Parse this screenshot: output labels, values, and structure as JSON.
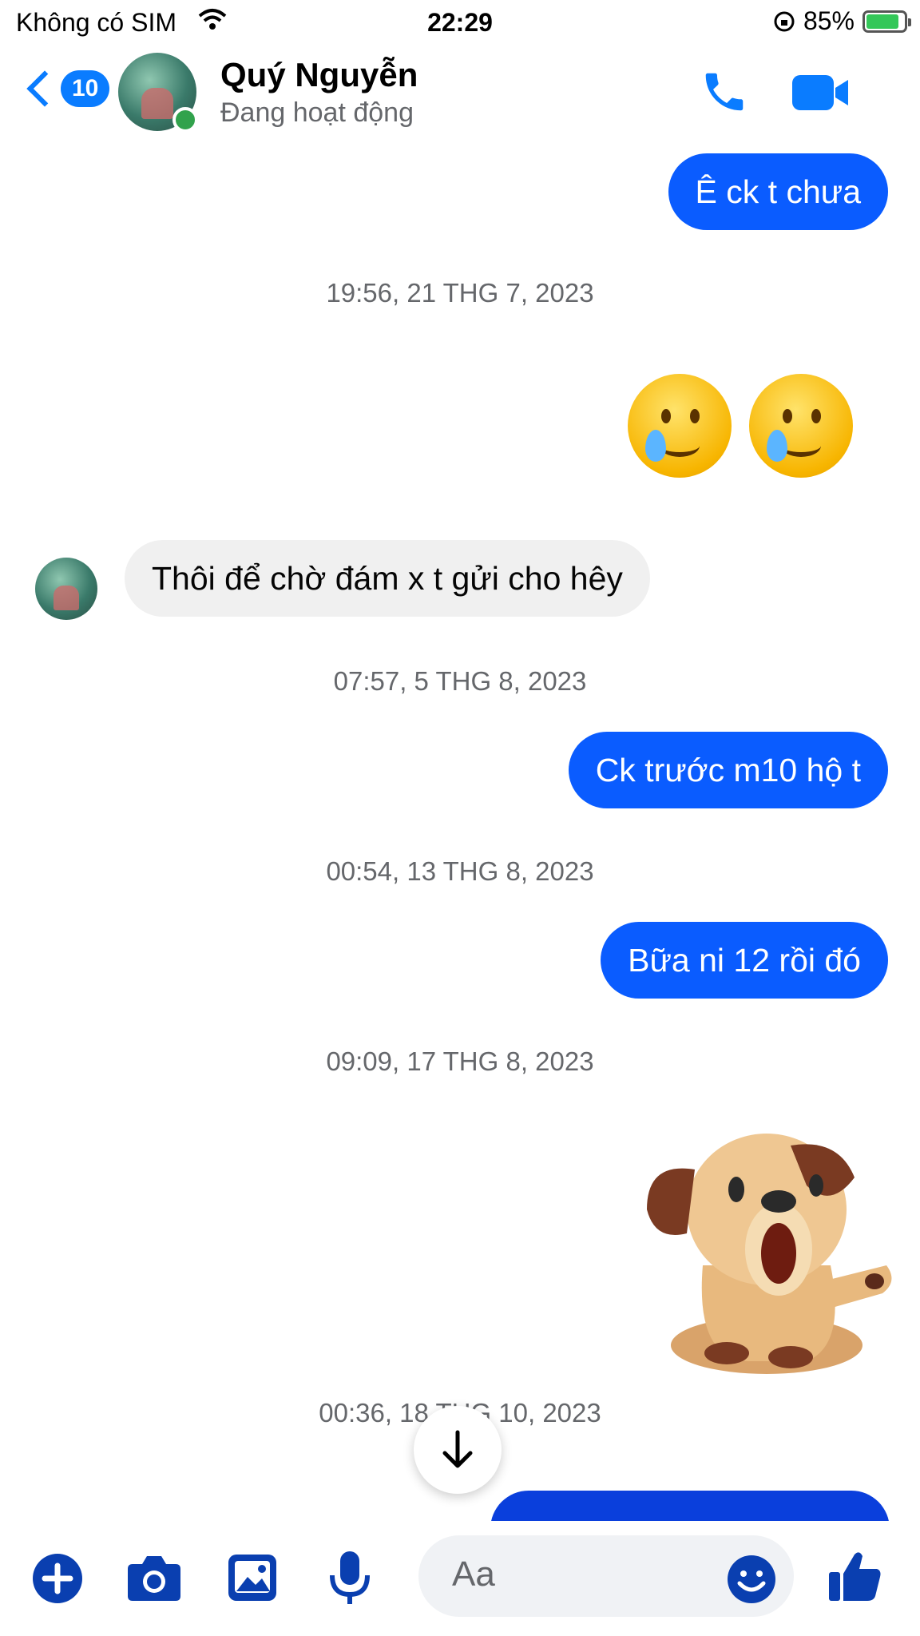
{
  "status_bar": {
    "carrier": "Không có SIM",
    "time": "22:29",
    "battery": "85%"
  },
  "header": {
    "back_badge": "10",
    "contact_name": "Quý Nguyễn",
    "contact_status": "Đang hoạt động"
  },
  "messages": {
    "m1": "Ê ck t chưa",
    "ts1": "19:56, 21 THG 7, 2023",
    "m2_emoji": "🥲🥲",
    "m3": "Thôi để chờ đám x t gửi cho hêy",
    "ts2": "07:57, 5 THG 8, 2023",
    "m4": "Ck trước m10 hộ t",
    "ts3": "00:54, 13 THG 8, 2023",
    "m5": "Bữa ni  12 rồi đó",
    "ts4": "09:09, 17 THG 8, 2023",
    "ts5": "00:36, 18 THG 10, 2023"
  },
  "composer": {
    "placeholder": "Aa"
  },
  "colors": {
    "accent": "#0a7cff",
    "outgoing_bubble": "#0a5cff",
    "incoming_bubble": "#f0f0f0",
    "online": "#31a24c"
  }
}
